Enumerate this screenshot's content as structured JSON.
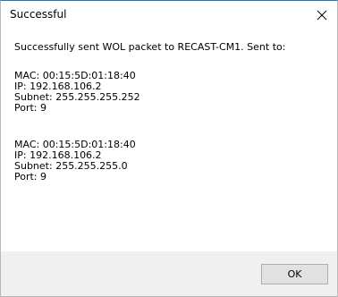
{
  "window": {
    "title": "Successful",
    "close_icon": "close-icon"
  },
  "message": {
    "heading": "Successfully sent WOL packet to RECAST-CM1. Sent to:",
    "entries": [
      {
        "mac": "MAC: 00:15:5D:01:18:40",
        "ip": "IP: 192.168.106.2",
        "subnet": "Subnet: 255.255.255.252",
        "port": "Port: 9"
      },
      {
        "mac": "MAC: 00:15:5D:01:18:40",
        "ip": "IP: 192.168.106.2",
        "subnet": "Subnet: 255.255.255.0",
        "port": "Port: 9"
      }
    ]
  },
  "footer": {
    "ok_label": "OK"
  },
  "colors": {
    "title_accent": "#1979ca",
    "footer_bg": "#f0f0f0",
    "button_bg": "#e1e1e1",
    "button_border": "#adadad"
  }
}
